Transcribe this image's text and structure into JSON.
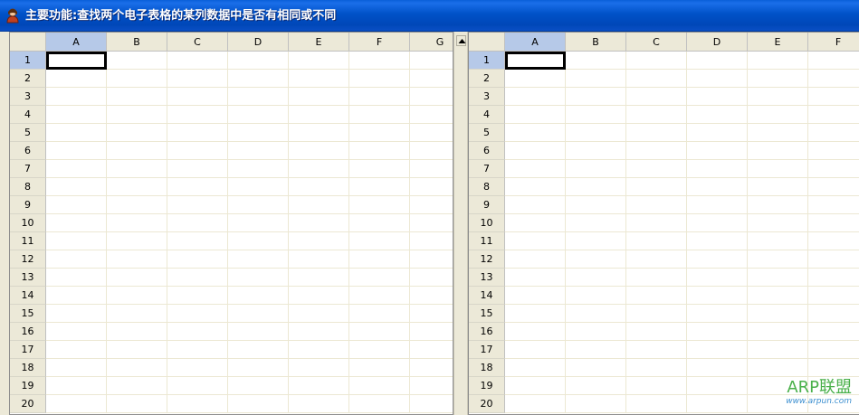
{
  "window": {
    "title": "主要功能:查找两个电子表格的某列数据中是否有相同或不同",
    "icon": "app-person-icon"
  },
  "left_grid": {
    "columns": [
      "A",
      "B",
      "C",
      "D",
      "E",
      "F",
      "G"
    ],
    "rows": [
      "1",
      "2",
      "3",
      "4",
      "5",
      "6",
      "7",
      "8",
      "9",
      "10",
      "11",
      "12",
      "13",
      "14",
      "15",
      "16",
      "17",
      "18",
      "19",
      "20"
    ],
    "active_column": "A",
    "active_row": "1"
  },
  "right_grid": {
    "columns": [
      "A",
      "B",
      "C",
      "D",
      "E",
      "F"
    ],
    "rows": [
      "1",
      "2",
      "3",
      "4",
      "5",
      "6",
      "7",
      "8",
      "9",
      "10",
      "11",
      "12",
      "13",
      "14",
      "15",
      "16",
      "17",
      "18",
      "19",
      "20"
    ],
    "active_column": "A",
    "active_row": "1"
  },
  "splitter": {
    "icon": "up-arrow-icon"
  },
  "watermark": {
    "main": "ARP联盟",
    "sub": "www.arpun.com"
  },
  "colors": {
    "titlebar": "#0052c8",
    "header_bg": "#ece9d8",
    "active_header": "#b6c9e8",
    "grid_line": "#ece8d3"
  }
}
